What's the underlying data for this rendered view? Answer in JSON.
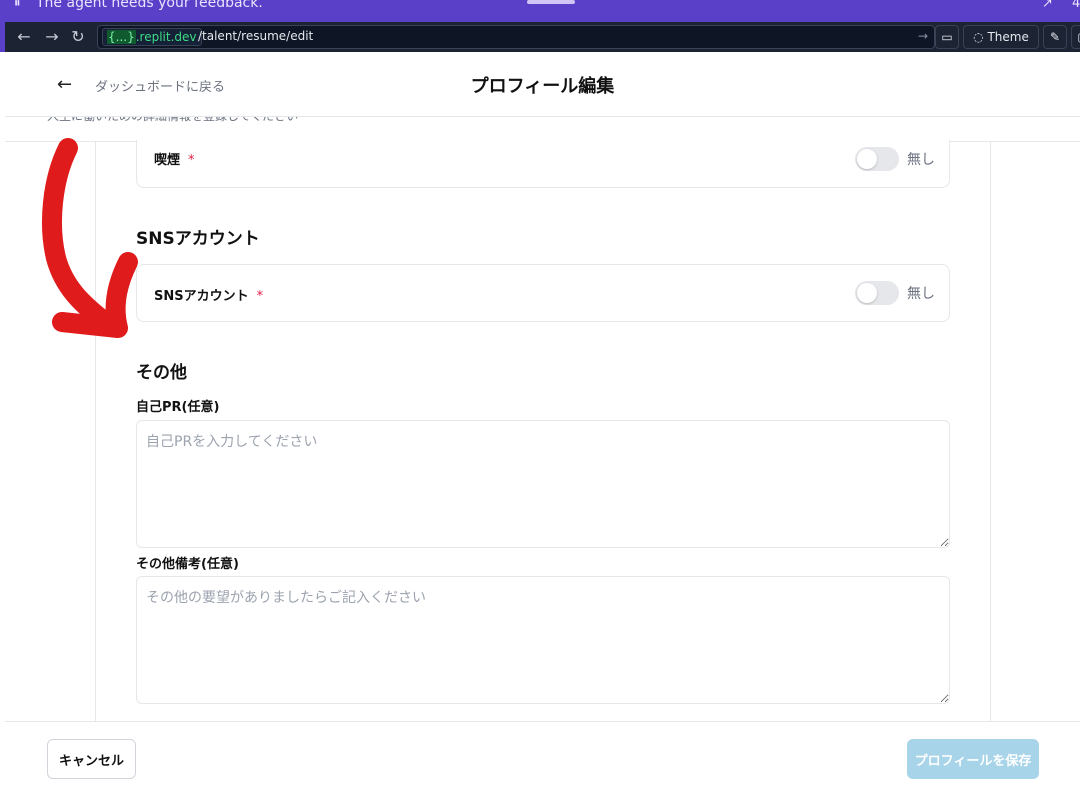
{
  "banner": {
    "pause_icon": "pause-icon",
    "message": "The agent needs your feedback.",
    "right_count": "4"
  },
  "browser": {
    "domain_brace": "{...}",
    "domain": ".replit.dev",
    "path": "/talent/resume/edit",
    "theme_label": "Theme"
  },
  "header": {
    "back_label": "ダッシュボードに戻る",
    "title": "プロフィール編集"
  },
  "peek_text": "人生に働いための詳細情報を登録してください",
  "smoking": {
    "label": "喫煙",
    "required_mark": "*",
    "toggle_value": "無し"
  },
  "sns": {
    "section_title": "SNSアカウント",
    "label": "SNSアカウント",
    "required_mark": "*",
    "toggle_value": "無し"
  },
  "other": {
    "section_title": "その他",
    "pr_label": "自己PR(任意)",
    "pr_placeholder": "自己PRを入力してください",
    "notes_label": "その他備考(任意)",
    "notes_placeholder": "その他の要望がありましたらご記入ください"
  },
  "footer": {
    "cancel_label": "キャンセル",
    "save_label": "プロフィールを保存"
  },
  "colors": {
    "banner": "#5a3fc8",
    "save_button": "#a7d4e8",
    "required": "#e11d48",
    "annotation": "#e01b1b"
  }
}
